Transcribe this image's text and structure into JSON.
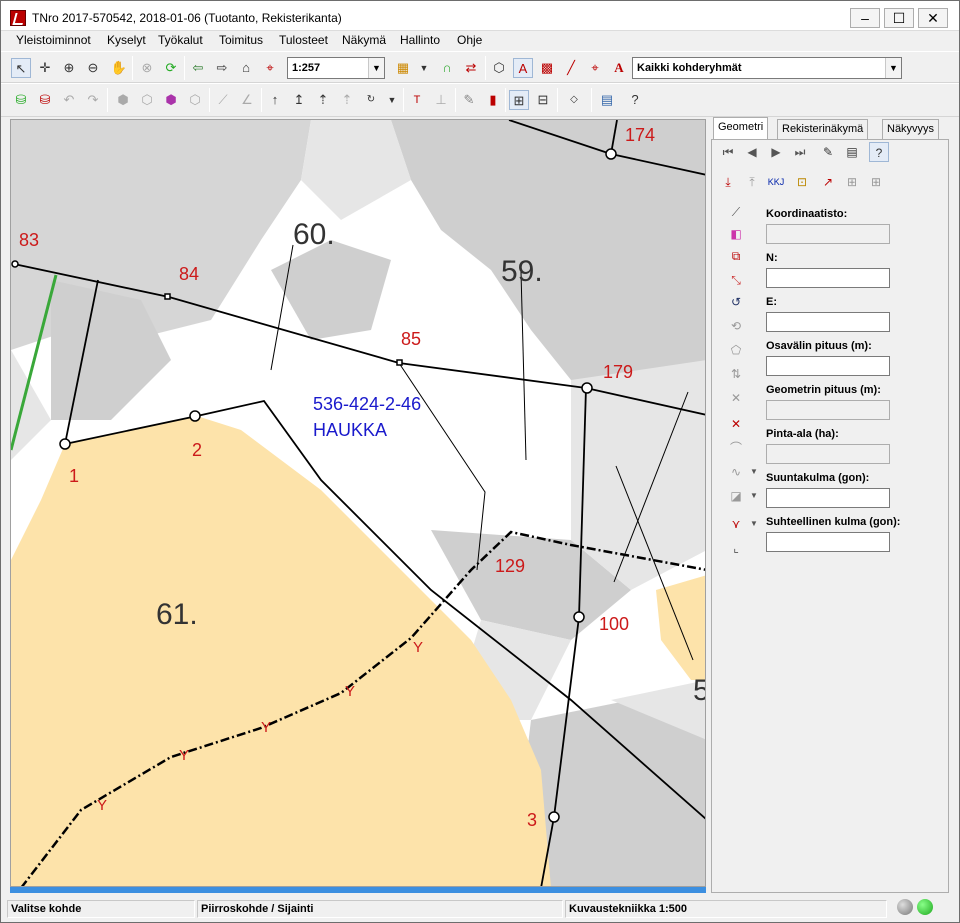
{
  "window": {
    "title": "TNro 2017-570542, 2018-01-06 (Tuotanto, Rekisterikanta)"
  },
  "menu": [
    "Yleistoiminnot",
    "Kyselyt",
    "Työkalut",
    "Toimitus",
    "Tulosteet",
    "Näkymä",
    "Hallinto",
    "Ohje"
  ],
  "toolbar": {
    "scale_value": "1:257",
    "group_value": "Kaikki kohderyhmät"
  },
  "map": {
    "parcel_id": "536-424-2-46",
    "parcel_name": "HAUKKA",
    "parcels": [
      "60.",
      "59.",
      "61.",
      "5"
    ],
    "points": [
      "83",
      "84",
      "85",
      "174",
      "179",
      "1",
      "2",
      "129",
      "100",
      "3"
    ],
    "boundary_marks": [
      "Y",
      "Y",
      "Y",
      "Y",
      "Y"
    ]
  },
  "sidepanel": {
    "tabs": [
      "Geometri",
      "Rekisterinäkymä",
      "Näkyvyys"
    ],
    "fields": {
      "coord_system": "Koordinaatisto:",
      "north": "N:",
      "east": "E:",
      "segment_length": "Osavälin pituus (m):",
      "geometry_length": "Geometrin pituus (m):",
      "area": "Pinta-ala (ha):",
      "bearing": "Suuntakulma (gon):",
      "relative_angle": "Suhteellinen kulma (gon):"
    },
    "kkj_label": "KKJ"
  },
  "status": {
    "left": "Valitse kohde",
    "middle": "Piirroskohde / Sijainti",
    "right": "Kuvaustekniikka 1:500"
  },
  "colors": {
    "parcel_fill": "#fde3aa",
    "road_gray": "#cdcdcd",
    "label_red": "#cc1a1a",
    "label_blue": "#1a1acc",
    "status_led": "#1fa81f"
  }
}
